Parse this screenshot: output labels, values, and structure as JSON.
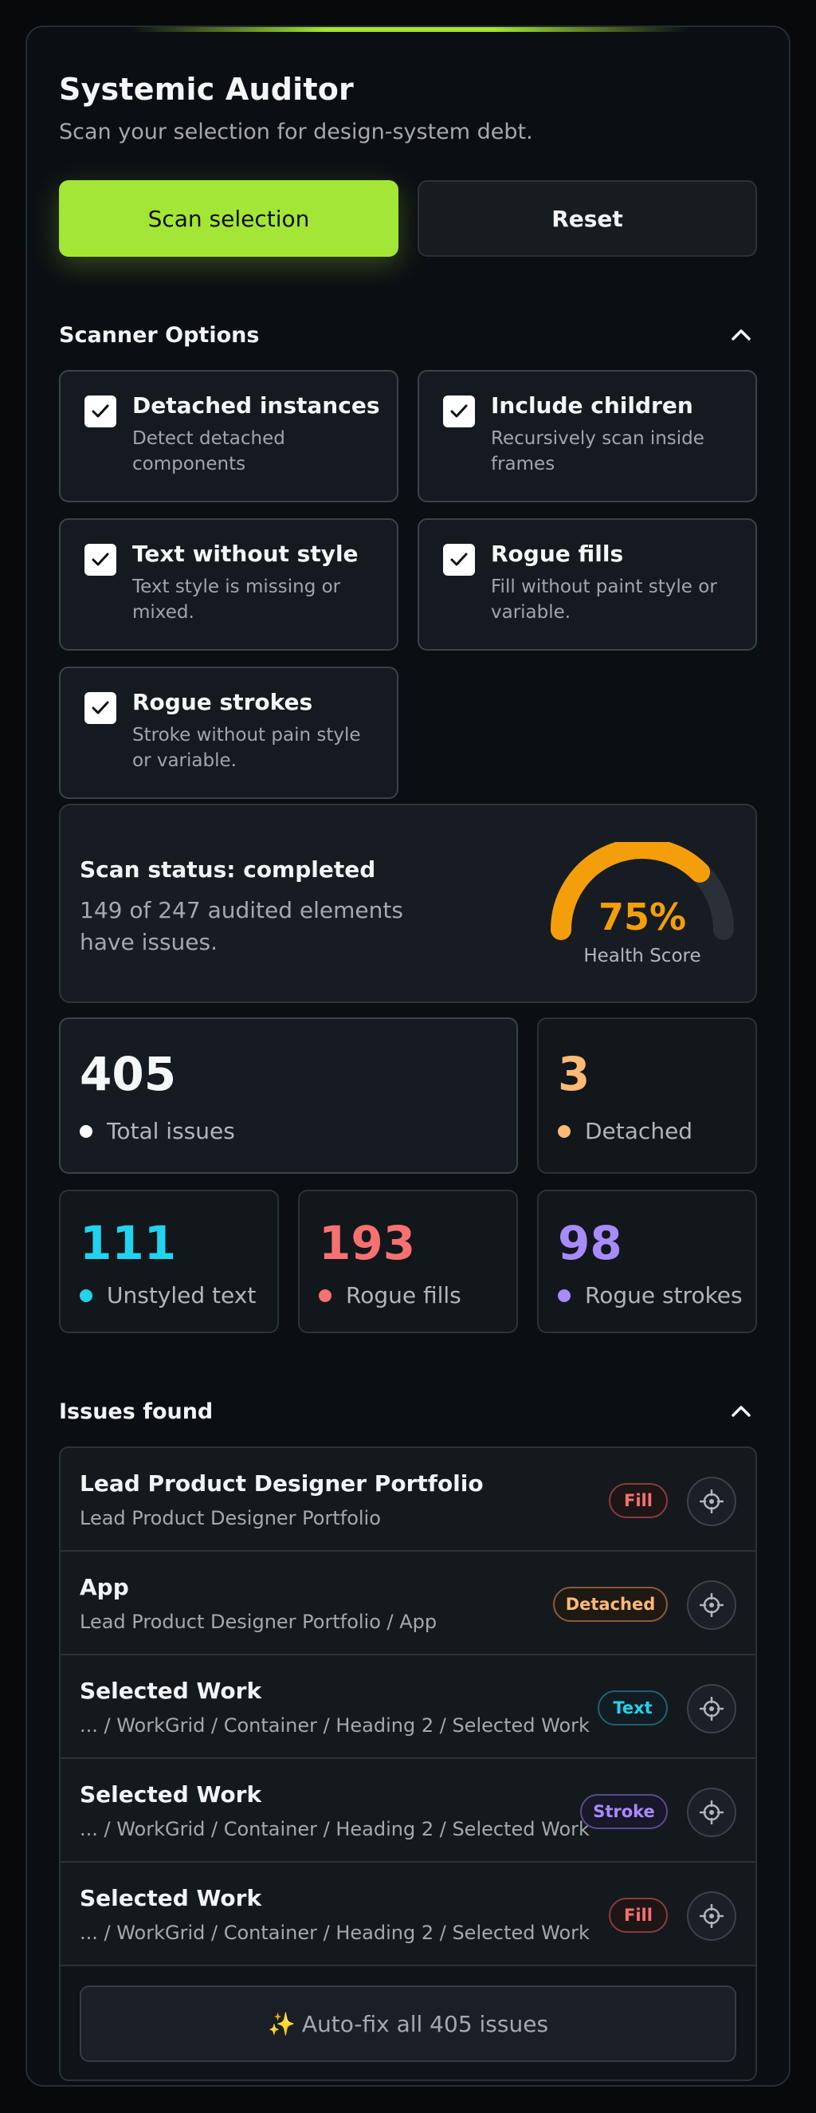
{
  "app": {
    "title": "Systemic Auditor",
    "subtitle": "Scan your selection for design-system debt."
  },
  "actions": {
    "scan_label": "Scan selection",
    "reset_label": "Reset"
  },
  "scanner_options": {
    "title": "Scanner Options",
    "items": [
      {
        "label": "Detached instances",
        "description": "Detect detached components",
        "checked": true
      },
      {
        "label": "Include children",
        "description": "Recursively scan inside frames",
        "checked": true
      },
      {
        "label": "Text without style",
        "description": "Text style is missing or mixed.",
        "checked": true
      },
      {
        "label": "Rogue fills",
        "description": "Fill without paint style or variable.",
        "checked": true
      },
      {
        "label": "Rogue strokes",
        "description": "Stroke without pain style or variable.",
        "checked": true
      }
    ]
  },
  "status": {
    "title": "Scan status: completed",
    "description": "149 of 247 audited elements have issues.",
    "health_score": "75%",
    "health_value": 0.75,
    "health_label": "Health Score",
    "gauge_color": "#f59e0b"
  },
  "stats": {
    "total": {
      "value": "405",
      "label": "Total issues",
      "color": "#ffffff"
    },
    "detached": {
      "value": "3",
      "label": "Detached",
      "color": "#fdba74"
    },
    "unstyled_text": {
      "value": "111",
      "label": "Unstyled text",
      "color": "#22d3ee"
    },
    "rogue_fills": {
      "value": "193",
      "label": "Rogue fills",
      "color": "#f87171"
    },
    "rogue_strokes": {
      "value": "98",
      "label": "Rogue strokes",
      "color": "#a78bfa"
    }
  },
  "issues": {
    "title": "Issues found",
    "rows": [
      {
        "name": "Lead Product Designer Portfolio",
        "path": "Lead Product Designer Portfolio",
        "badge": "Fill",
        "badge_color": "#f87171"
      },
      {
        "name": "App",
        "path": "Lead Product Designer Portfolio / App",
        "badge": "Detached",
        "badge_color": "#fdba74"
      },
      {
        "name": "Selected Work",
        "path": "... / WorkGrid / Container / Heading 2 / Selected Work",
        "badge": "Text",
        "badge_color": "#22d3ee"
      },
      {
        "name": "Selected Work",
        "path": "... / WorkGrid / Container / Heading 2 / Selected Work",
        "badge": "Stroke",
        "badge_color": "#a78bfa"
      },
      {
        "name": "Selected Work",
        "path": "... / WorkGrid / Container / Heading 2 / Selected Work",
        "badge": "Fill",
        "badge_color": "#f87171"
      }
    ],
    "autofix_icon": "✨",
    "autofix_label": "Auto-fix all 405 issues"
  },
  "colors": {
    "accent": "#a3e635",
    "background": "#07090b",
    "panel": "#0b0f13"
  }
}
